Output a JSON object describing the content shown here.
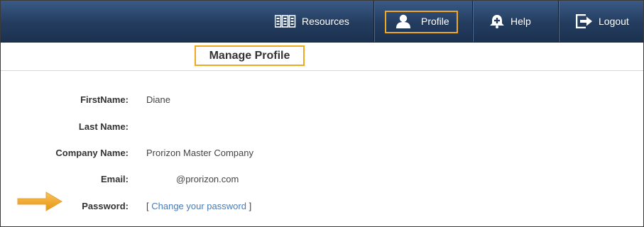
{
  "nav": {
    "resources_label": "Resources",
    "profile_label": "Profile",
    "help_label": "Help",
    "logout_label": "Logout"
  },
  "page": {
    "title": "Manage Profile"
  },
  "profile": {
    "first_name_label": "FirstName:",
    "first_name_value": "Diane",
    "last_name_label": "Last Name:",
    "last_name_value": "",
    "company_label": "Company Name:",
    "company_value": "Prorizon Master Company",
    "email_label": "Email:",
    "email_value": "@prorizon.com",
    "password_label": "Password:",
    "password_open_bracket": "[",
    "password_link": "Change your password",
    "password_close_bracket": "]"
  },
  "icons": {
    "resources": "books-icon",
    "profile": "user-icon",
    "help": "help-bell-icon",
    "logout": "logout-arrow-icon",
    "pointer": "orange-arrow-icon"
  },
  "colors": {
    "navbar": "#233c5e",
    "highlight": "#f0a820",
    "link": "#4a7bb7"
  }
}
